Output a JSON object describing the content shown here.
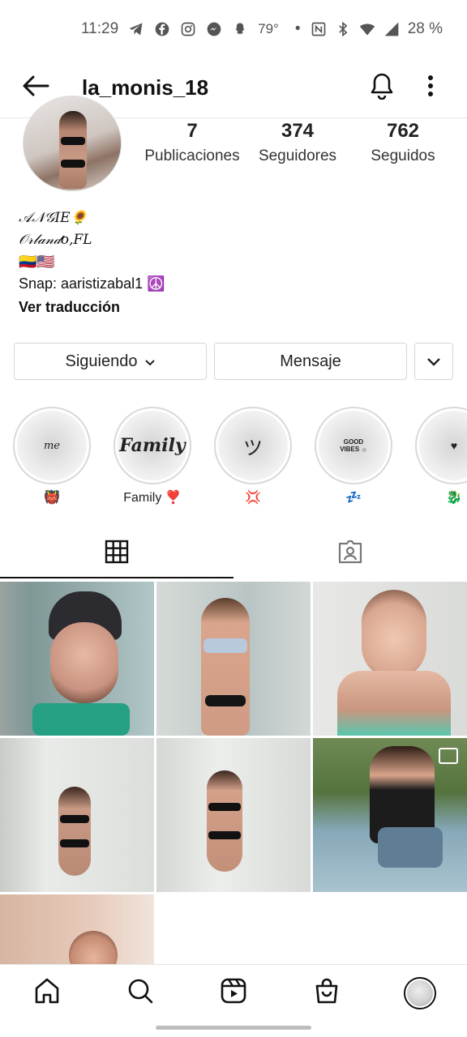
{
  "status_bar": {
    "time": "11:29",
    "temperature": "79°",
    "dot": "•",
    "battery": "28 %",
    "left_icons": [
      "telegram-icon",
      "facebook-icon",
      "instagram-icon",
      "messenger-icon",
      "snapchat-icon"
    ],
    "right_icons": [
      "nfc-icon",
      "bluetooth-icon",
      "wifi-icon",
      "signal-icon"
    ]
  },
  "header": {
    "username": "la_monis_18",
    "back_icon": "arrow-left-icon",
    "notification_icon": "bell-icon",
    "more_icon": "more-vertical-icon"
  },
  "profile": {
    "stats": [
      {
        "value": "7",
        "label": "Publicaciones"
      },
      {
        "value": "374",
        "label": "Seguidores"
      },
      {
        "value": "762",
        "label": "Seguidos"
      }
    ],
    "bio": {
      "name": "𝒜𝒩𝒢𝐼𝐸🌻",
      "city": "𝒪𝓇𝓁𝒶𝓃𝒹𝑜,𝐹𝐿",
      "flags": "🇨🇴🇺🇸",
      "snap": "Snap: aaristizabal1 ☮️",
      "translate": "Ver traducción"
    }
  },
  "actions": {
    "following_label": "Siguiendo",
    "message_label": "Mensaje"
  },
  "highlights": [
    {
      "cover_text": "me",
      "label": "👹"
    },
    {
      "cover_text": "Family",
      "label": "Family ❣️"
    },
    {
      "cover_text": "ツ",
      "label": "💢"
    },
    {
      "cover_text": "GOOD VIBES ☼",
      "label": "💤"
    },
    {
      "cover_text": "♥",
      "label": "🐉"
    }
  ],
  "tabs": [
    "grid-icon",
    "tagged-icon"
  ],
  "bottom_nav": [
    "home-icon",
    "search-icon",
    "reels-icon",
    "shop-icon",
    "profile-avatar"
  ],
  "colors": {
    "text": "#111111",
    "border": "#d6d6d6",
    "muted": "#555555"
  }
}
